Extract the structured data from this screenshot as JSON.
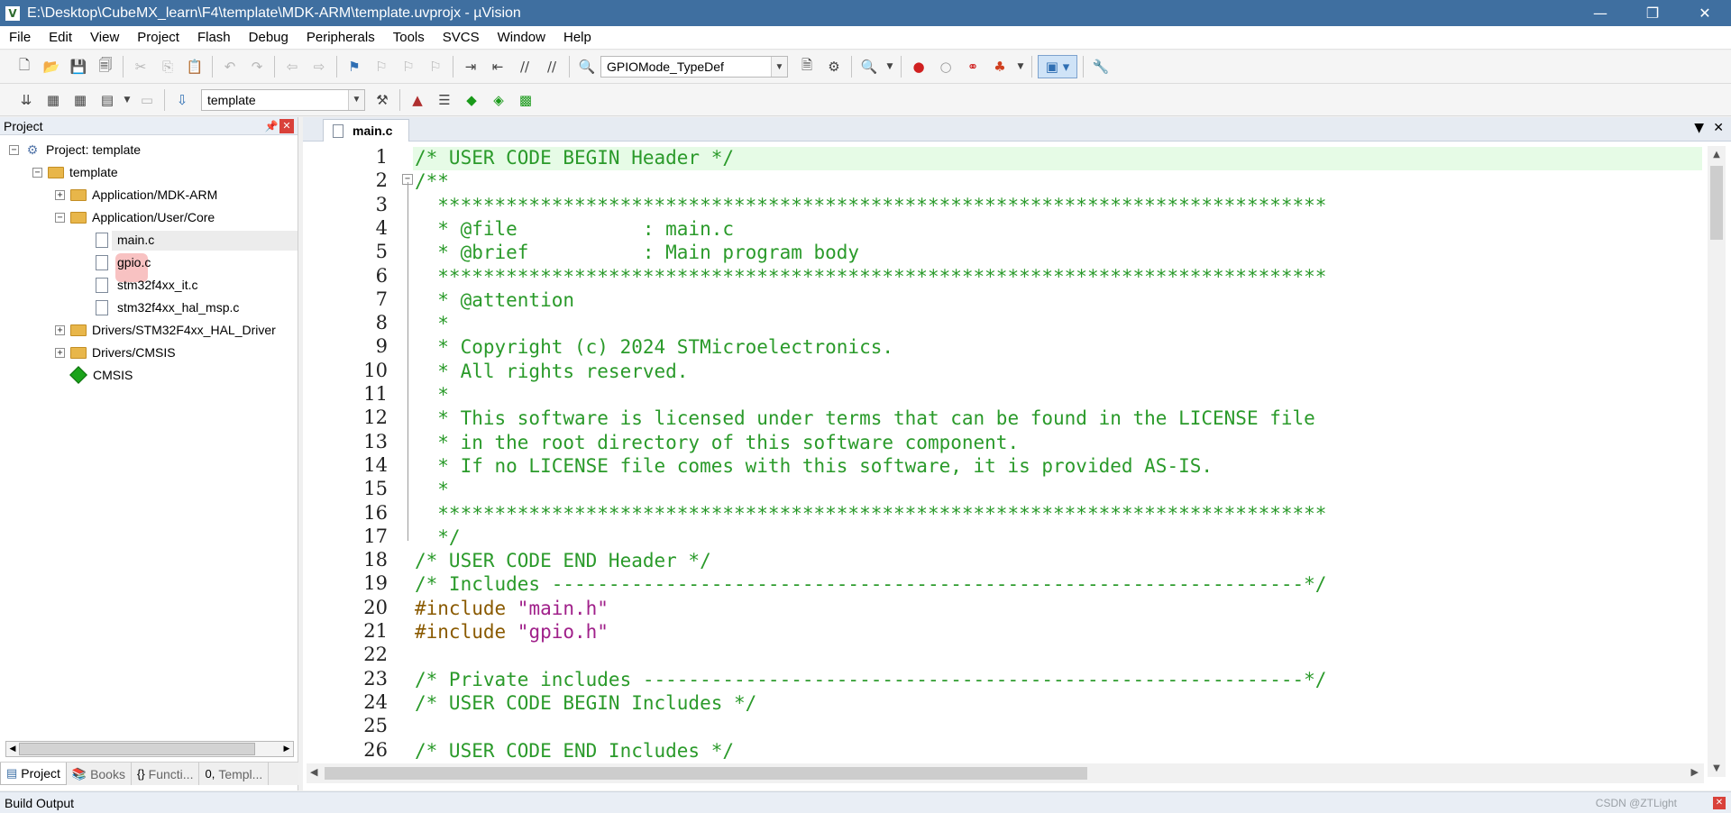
{
  "window": {
    "title": "E:\\Desktop\\CubeMX_learn\\F4\\template\\MDK-ARM\\template.uvprojx - µVision",
    "app_icon": "keil-icon",
    "minimize_glyph": "—",
    "restore_glyph": "❐",
    "close_glyph": "✕"
  },
  "menu": [
    "File",
    "Edit",
    "View",
    "Project",
    "Flash",
    "Debug",
    "Peripherals",
    "Tools",
    "SVCS",
    "Window",
    "Help"
  ],
  "toolbar1": {
    "find_combo_value": "GPIOMode_TypeDef"
  },
  "toolbar2": {
    "target_combo_value": "template"
  },
  "project_panel": {
    "title": "Project",
    "pin_glyph": "📌",
    "close_glyph": "✕",
    "tree": [
      {
        "label": "Project: template",
        "level": 0,
        "type": "project",
        "expander": "−"
      },
      {
        "label": "template",
        "level": 1,
        "type": "target",
        "expander": "−"
      },
      {
        "label": "Application/MDK-ARM",
        "level": 2,
        "type": "folder",
        "expander": "+"
      },
      {
        "label": "Application/User/Core",
        "level": 2,
        "type": "folder-open",
        "expander": "−"
      },
      {
        "label": "main.c",
        "level": 3,
        "type": "file"
      },
      {
        "label": "gpio.c",
        "level": 3,
        "type": "file"
      },
      {
        "label": "stm32f4xx_it.c",
        "level": 3,
        "type": "file"
      },
      {
        "label": "stm32f4xx_hal_msp.c",
        "level": 3,
        "type": "file"
      },
      {
        "label": "Drivers/STM32F4xx_HAL_Driver",
        "level": 2,
        "type": "folder",
        "expander": "+"
      },
      {
        "label": "Drivers/CMSIS",
        "level": 2,
        "type": "folder",
        "expander": "+"
      },
      {
        "label": "CMSIS",
        "level": 2,
        "type": "component"
      }
    ],
    "tabs": [
      {
        "label": "Project",
        "icon": "project-icon"
      },
      {
        "label": "Books",
        "icon": "books-icon"
      },
      {
        "label": "Functi...",
        "icon": "functions-icon"
      },
      {
        "label": "Templ...",
        "icon": "templates-icon"
      }
    ]
  },
  "editor": {
    "tab_label": "main.c",
    "lines": [
      {
        "n": "1",
        "parts": [
          {
            "t": "/* USER CODE BEGIN Header */",
            "c": "cmt"
          }
        ]
      },
      {
        "n": "2",
        "parts": [
          {
            "t": "/**",
            "c": "cmt"
          }
        ]
      },
      {
        "n": "3",
        "parts": [
          {
            "t": "  ******************************************************************************",
            "c": "cmt"
          }
        ]
      },
      {
        "n": "4",
        "parts": [
          {
            "t": "  * @file           : main.c",
            "c": "cmt"
          }
        ]
      },
      {
        "n": "5",
        "parts": [
          {
            "t": "  * @brief          : Main program body",
            "c": "cmt"
          }
        ]
      },
      {
        "n": "6",
        "parts": [
          {
            "t": "  ******************************************************************************",
            "c": "cmt"
          }
        ]
      },
      {
        "n": "7",
        "parts": [
          {
            "t": "  * @attention",
            "c": "cmt"
          }
        ]
      },
      {
        "n": "8",
        "parts": [
          {
            "t": "  *",
            "c": "cmt"
          }
        ]
      },
      {
        "n": "9",
        "parts": [
          {
            "t": "  * Copyright (c) 2024 STMicroelectronics.",
            "c": "cmt"
          }
        ]
      },
      {
        "n": "10",
        "parts": [
          {
            "t": "  * All rights reserved.",
            "c": "cmt"
          }
        ]
      },
      {
        "n": "11",
        "parts": [
          {
            "t": "  *",
            "c": "cmt"
          }
        ]
      },
      {
        "n": "12",
        "parts": [
          {
            "t": "  * This software is licensed under terms that can be found in the LICENSE file",
            "c": "cmt"
          }
        ]
      },
      {
        "n": "13",
        "parts": [
          {
            "t": "  * in the root directory of this software component.",
            "c": "cmt"
          }
        ]
      },
      {
        "n": "14",
        "parts": [
          {
            "t": "  * If no LICENSE file comes with this software, it is provided AS-IS.",
            "c": "cmt"
          }
        ]
      },
      {
        "n": "15",
        "parts": [
          {
            "t": "  *",
            "c": "cmt"
          }
        ]
      },
      {
        "n": "16",
        "parts": [
          {
            "t": "  ******************************************************************************",
            "c": "cmt"
          }
        ]
      },
      {
        "n": "17",
        "parts": [
          {
            "t": "  */",
            "c": "cmt"
          }
        ]
      },
      {
        "n": "18",
        "parts": [
          {
            "t": "/* USER CODE END Header */",
            "c": "cmt"
          }
        ]
      },
      {
        "n": "19",
        "parts": [
          {
            "t": "/* Includes ------------------------------------------------------------------*/",
            "c": "cmt"
          }
        ]
      },
      {
        "n": "20",
        "parts": [
          {
            "t": "#include ",
            "c": "pre"
          },
          {
            "t": "\"main.h\"",
            "c": "str"
          }
        ]
      },
      {
        "n": "21",
        "parts": [
          {
            "t": "#include ",
            "c": "pre"
          },
          {
            "t": "\"gpio.h\"",
            "c": "str"
          }
        ]
      },
      {
        "n": "22",
        "parts": []
      },
      {
        "n": "23",
        "parts": [
          {
            "t": "/* Private includes ----------------------------------------------------------*/",
            "c": "cmt"
          }
        ]
      },
      {
        "n": "24",
        "parts": [
          {
            "t": "/* USER CODE BEGIN Includes */",
            "c": "cmt"
          }
        ]
      },
      {
        "n": "25",
        "parts": []
      },
      {
        "n": "26",
        "parts": [
          {
            "t": "/* USER CODE END Includes */",
            "c": "cmt"
          }
        ]
      }
    ]
  },
  "build_output": {
    "title": "Build Output",
    "watermark": "CSDN @ZTLight"
  },
  "colors": {
    "titlebar": "#3f6fa0",
    "comment": "#2a9a2a",
    "preprocessor": "#8a5a00",
    "string": "#a0208a",
    "current_line": "#e6fbe6"
  }
}
